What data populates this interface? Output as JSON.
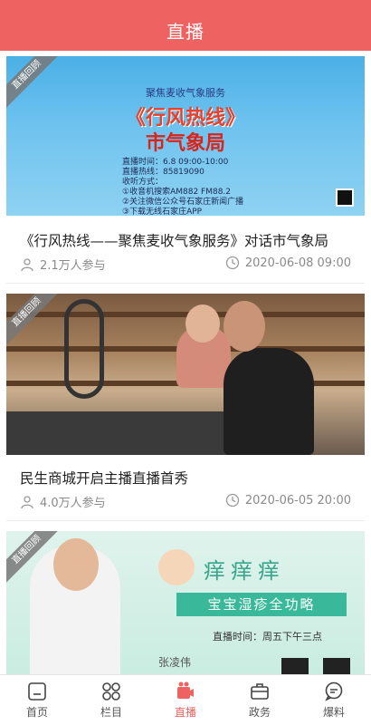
{
  "header": {
    "title": "直播"
  },
  "badge_text": "直播回顾",
  "cards": [
    {
      "title": "《行风热线——聚焦麦收气象服务》对话市气象局",
      "views": "2.1万人参与",
      "date": "2020-06-08 09:00",
      "thumb": {
        "line1": "聚焦麦收气象服务",
        "line2": "《行风热线》",
        "line3": "市气象局",
        "info1": "直播时间：6.8 09:00-10:00",
        "info2": "直播热线：85819090",
        "info3": "收听方式：",
        "info4": "①收音机搜索AM882 FM88.2",
        "info5": "②关注微信公众号石家庄新闻广播",
        "info6": "③下载无线石家庄APP"
      }
    },
    {
      "title": "民生商城开启主播直播首秀",
      "views": "4.0万人参与",
      "date": "2020-06-05 20:00"
    },
    {
      "thumb": {
        "headline": "痒痒痒",
        "sub": "宝宝湿疹全功略",
        "time": "直播时间：周五下午三点",
        "name": "张凌伟"
      }
    }
  ],
  "tabbar": [
    {
      "label": "首页",
      "icon": "home-icon"
    },
    {
      "label": "栏目",
      "icon": "grid-icon"
    },
    {
      "label": "直播",
      "icon": "live-icon",
      "active": true
    },
    {
      "label": "政务",
      "icon": "briefcase-icon"
    },
    {
      "label": "爆料",
      "icon": "chat-icon"
    }
  ],
  "colors": {
    "accent": "#ee6262",
    "muted": "#8a8a8a"
  }
}
